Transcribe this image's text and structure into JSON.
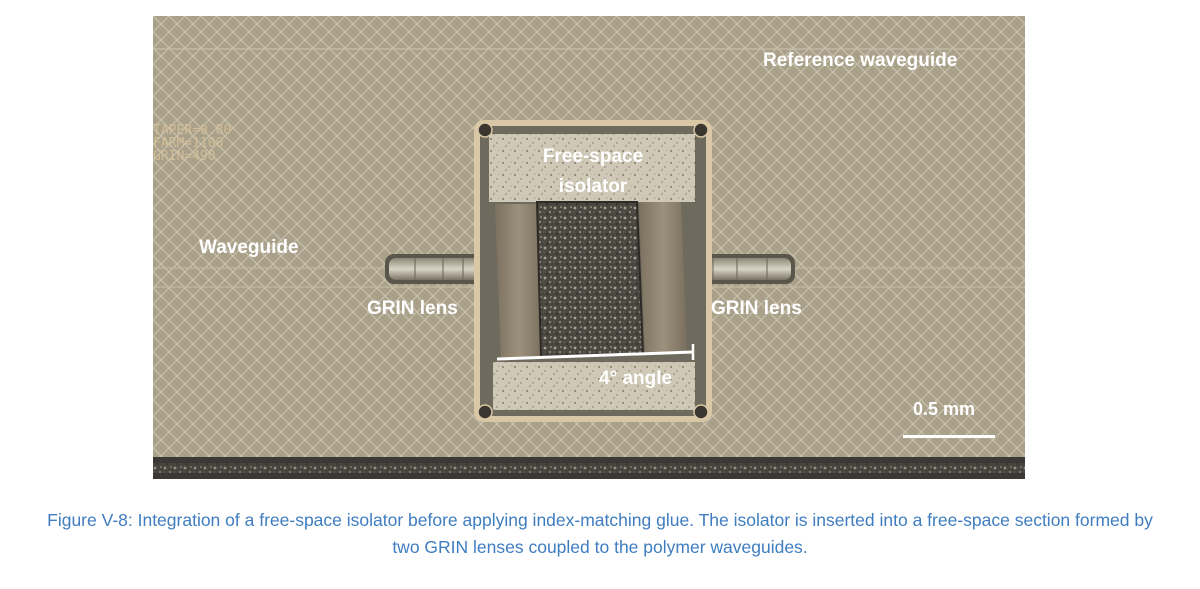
{
  "figure": {
    "labels": {
      "reference_waveguide": "Reference waveguide",
      "waveguide": "Waveguide",
      "free_space_line1": "Free-space",
      "free_space_line2": "isolator",
      "grin_left": "GRIN lens",
      "grin_right": "GRIN lens",
      "angle": "4° angle",
      "scale": "0.5 mm"
    },
    "engraving": {
      "line1": "TAPER=0.80",
      "line2": "FARM=1100",
      "line3": "GRIN=490"
    }
  },
  "caption": "Figure V-8: Integration of a free-space isolator before applying index-matching glue. The isolator is inserted into a free-space section formed by two GRIN lenses coupled to the polymer waveguides.",
  "colors": {
    "caption": "#3f7dc0",
    "substrate": "#a9a089",
    "label_text": "#ffffff"
  }
}
